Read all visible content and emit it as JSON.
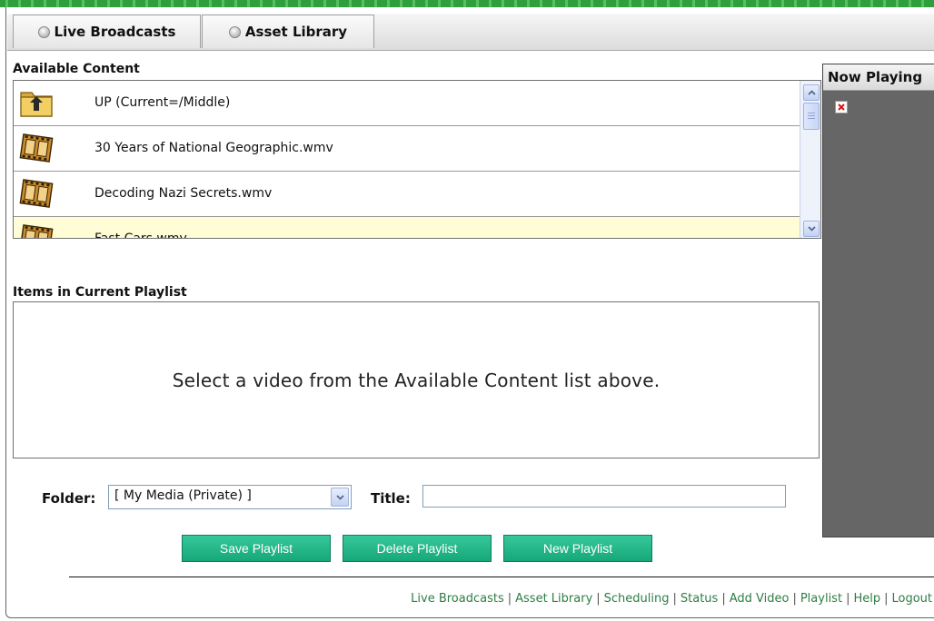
{
  "tabs": [
    {
      "label": "Live Broadcasts"
    },
    {
      "label": "Asset Library"
    }
  ],
  "available_content": {
    "label": "Available Content",
    "items": [
      {
        "label": "UP (Current=/Middle)",
        "icon": "folder-up-icon"
      },
      {
        "label": "30 Years of National Geographic.wmv",
        "icon": "film-reel-icon"
      },
      {
        "label": "Decoding Nazi Secrets.wmv",
        "icon": "film-reel-icon"
      },
      {
        "label": "Fast Cars.wmv",
        "icon": "film-reel-icon"
      }
    ]
  },
  "playlist": {
    "label": "Items in Current Playlist",
    "empty_message": "Select a video from the Available Content list above."
  },
  "now_playing": {
    "label": "Now Playing"
  },
  "form": {
    "folder_label": "Folder:",
    "folder_value": "[ My Media (Private) ]",
    "title_label": "Title:",
    "title_value": ""
  },
  "buttons": {
    "save": "Save Playlist",
    "delete": "Delete Playlist",
    "new": "New Playlist"
  },
  "footer": {
    "links": [
      "Live Broadcasts",
      "Asset Library",
      "Scheduling",
      "Status",
      "Add Video",
      "Playlist",
      "Help",
      "Logout"
    ]
  },
  "colors": {
    "button_green": "#1fb486",
    "link_green": "#2e7d44",
    "selected_row": "#fffdd6",
    "now_playing_bg": "#666666"
  }
}
